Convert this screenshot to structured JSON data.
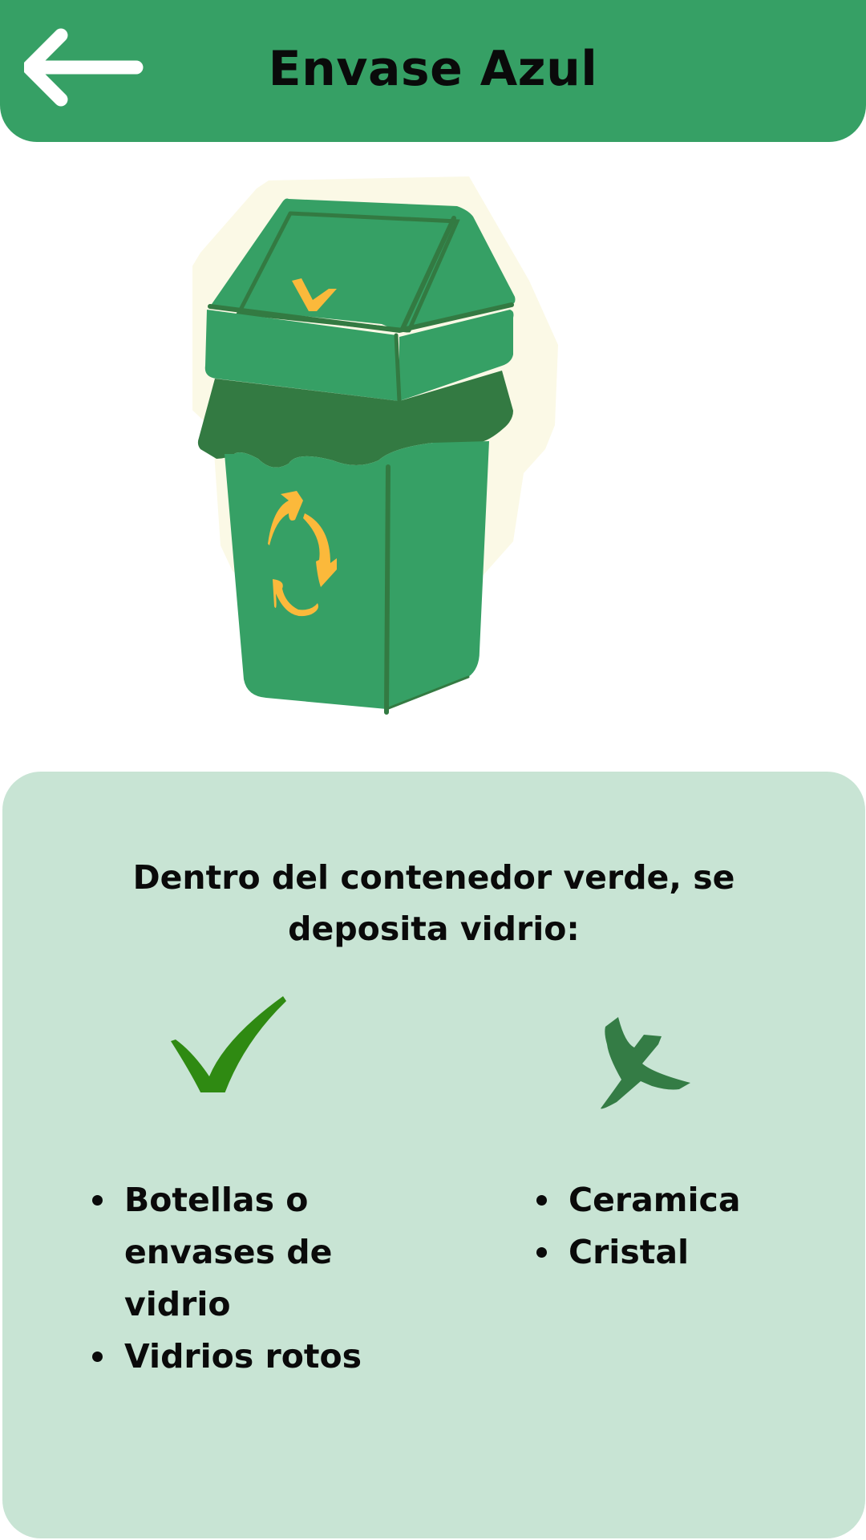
{
  "header": {
    "title": "Envase Azul",
    "back_icon": "arrow-left-icon"
  },
  "illustration": {
    "icon": "recycling-bin-icon",
    "colors": {
      "bin": "#36a065",
      "outline": "#337a42",
      "accent": "#fbb93b",
      "halo": "#fbf9e6"
    }
  },
  "card": {
    "heading": "Dentro del contenedor verde, se deposita vidrio:",
    "allowed": {
      "icon": "check-icon",
      "items": [
        "Botellas o envases de vidrio",
        "Vidrios rotos"
      ]
    },
    "forbidden": {
      "icon": "cross-icon",
      "items": [
        "Ceramica",
        "Cristal"
      ]
    }
  },
  "colors": {
    "header": "#36a065",
    "card": "#c8e4d4",
    "check": "#2f8a12",
    "cross": "#347c45"
  }
}
